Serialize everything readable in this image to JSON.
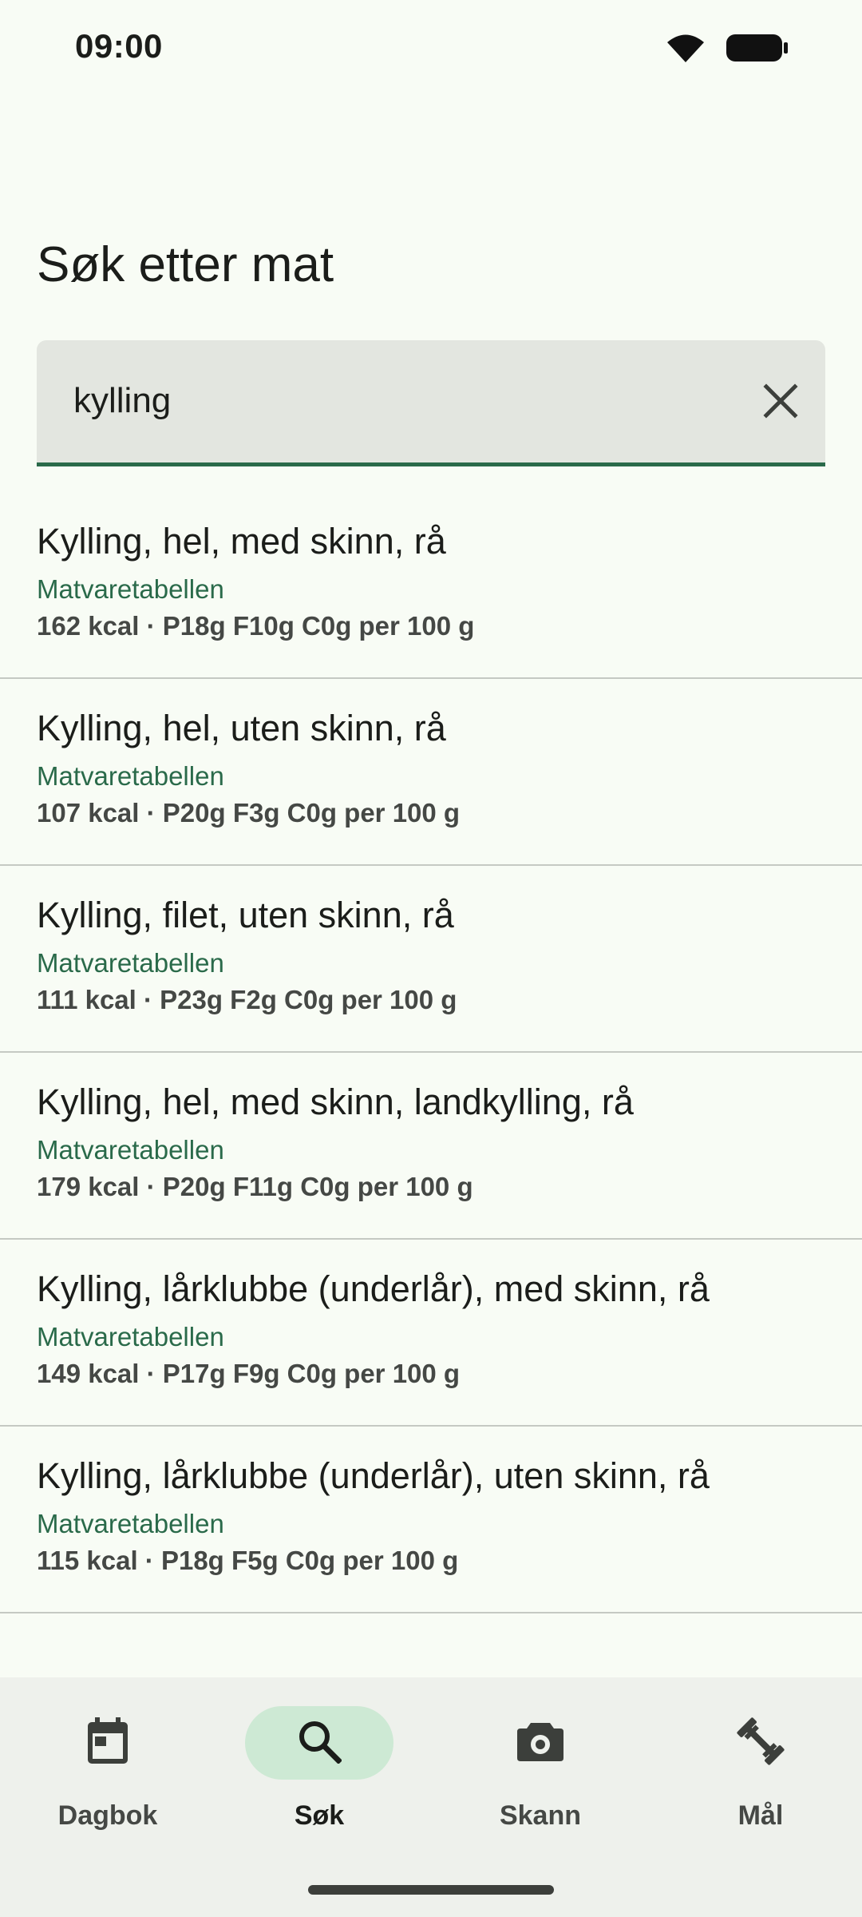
{
  "status": {
    "time": "09:00"
  },
  "page": {
    "title": "Søk etter mat"
  },
  "search": {
    "value": "kylling",
    "placeholder": ""
  },
  "results": [
    {
      "name": "Kylling, hel, med skinn, rå",
      "source": "Matvaretabellen",
      "nutrition": "162 kcal · P18g F10g C0g per 100 g"
    },
    {
      "name": "Kylling, hel, uten skinn, rå",
      "source": "Matvaretabellen",
      "nutrition": "107 kcal · P20g F3g C0g per 100 g"
    },
    {
      "name": "Kylling, filet, uten skinn, rå",
      "source": "Matvaretabellen",
      "nutrition": "111 kcal · P23g F2g C0g per 100 g"
    },
    {
      "name": "Kylling, hel, med skinn, landkylling, rå",
      "source": "Matvaretabellen",
      "nutrition": "179 kcal · P20g F11g C0g per 100 g"
    },
    {
      "name": "Kylling, lårklubbe (underlår), med skinn, rå",
      "source": "Matvaretabellen",
      "nutrition": "149 kcal · P17g F9g C0g per 100 g"
    },
    {
      "name": "Kylling, lårklubbe (underlår), uten skinn, rå",
      "source": "Matvaretabellen",
      "nutrition": "115 kcal · P18g F5g C0g per 100 g"
    }
  ],
  "nav": [
    {
      "label": "Dagbok",
      "icon": "calendar-icon",
      "active": false
    },
    {
      "label": "Søk",
      "icon": "search-icon",
      "active": true
    },
    {
      "label": "Skann",
      "icon": "camera-icon",
      "active": false
    },
    {
      "label": "Mål",
      "icon": "fitness-icon",
      "active": false
    }
  ],
  "colors": {
    "background": "#f8fcf5",
    "accent": "#2a6a4a",
    "nav_active": "#cde9d4",
    "search_bg": "#e3e6e0"
  }
}
